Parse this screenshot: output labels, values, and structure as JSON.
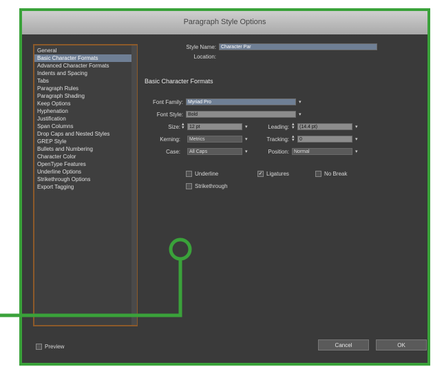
{
  "window": {
    "title": "Paragraph Style Options"
  },
  "categories": [
    "General",
    "Basic Character Formats",
    "Advanced Character Formats",
    "Indents and Spacing",
    "Tabs",
    "Paragraph Rules",
    "Paragraph Shading",
    "Keep Options",
    "Hyphenation",
    "Justification",
    "Span Columns",
    "Drop Caps and Nested Styles",
    "GREP Style",
    "Bullets and Numbering",
    "Character Color",
    "OpenType Features",
    "Underline Options",
    "Strikethrough Options",
    "Export Tagging"
  ],
  "selected_category_index": 1,
  "form": {
    "style_name_label": "Style Name:",
    "style_name_value": "Character Par",
    "location_label": "Location:",
    "section_title": "Basic Character Formats",
    "font_family_label": "Font Family:",
    "font_family_value": "Myriad Pro",
    "font_style_label": "Font Style:",
    "font_style_value": "Bold",
    "size_label": "Size:",
    "size_value": "12 pt",
    "leading_label": "Leading:",
    "leading_value": "(14.4 pt)",
    "kerning_label": "Kerning:",
    "kerning_value": "Metrics",
    "tracking_label": "Tracking:",
    "tracking_value": "0",
    "case_label": "Case:",
    "case_value": "All Caps",
    "position_label": "Position:",
    "position_value": "Normal",
    "checkboxes": {
      "underline": {
        "label": "Underline",
        "checked": false
      },
      "ligatures": {
        "label": "Ligatures",
        "checked": true
      },
      "no_break": {
        "label": "No Break",
        "checked": false
      },
      "strikethrough": {
        "label": "Strikethrough",
        "checked": false
      }
    }
  },
  "footer": {
    "preview_label": "Preview",
    "cancel_label": "Cancel",
    "ok_label": "OK"
  },
  "colors": {
    "annotation": "#3aa23a",
    "category_border": "#8d5a2a",
    "selection": "#6f7f95"
  }
}
